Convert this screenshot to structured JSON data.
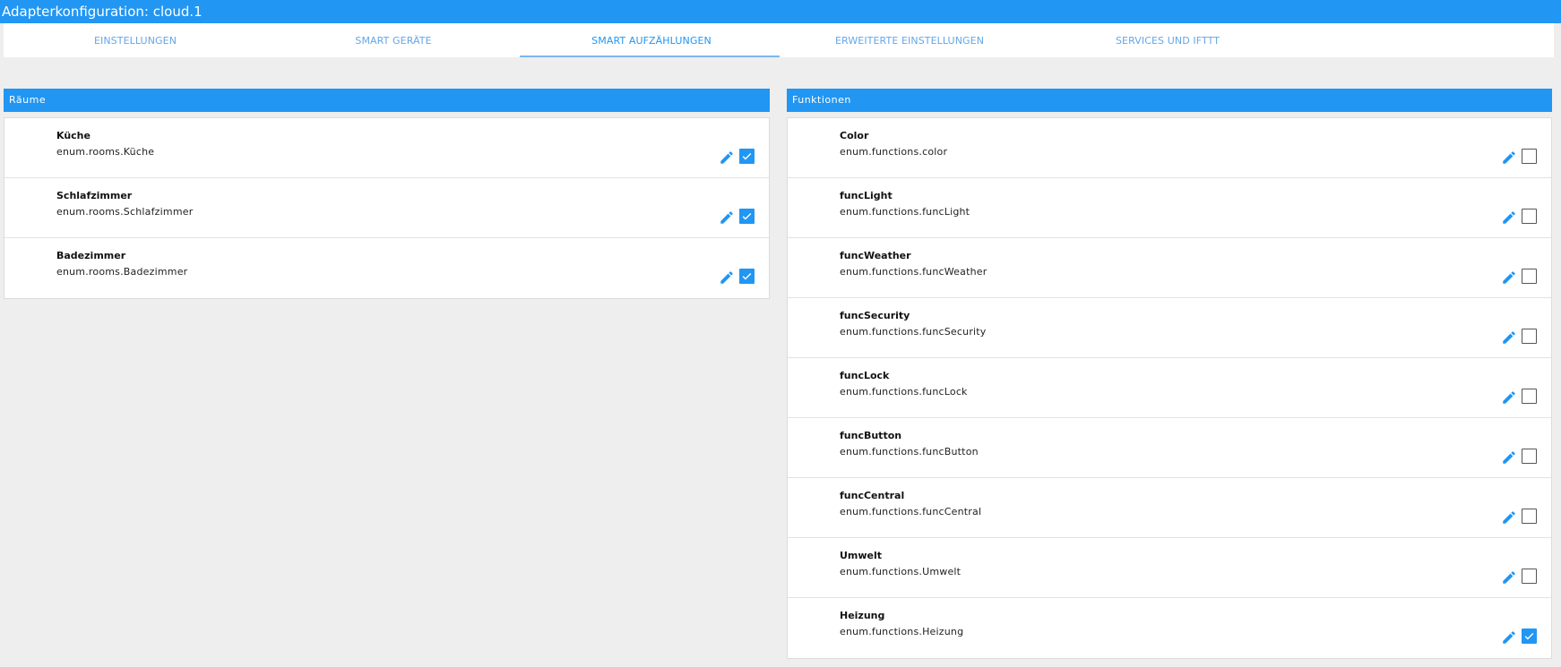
{
  "window": {
    "title": "Adapterkonfiguration: cloud.1"
  },
  "tabs": [
    {
      "label": "EINSTELLUNGEN",
      "active": false
    },
    {
      "label": "SMART GERÄTE",
      "active": false
    },
    {
      "label": "SMART AUFZÄHLUNGEN",
      "active": true
    },
    {
      "label": "ERWEITERTE EINSTELLUNGEN",
      "active": false
    },
    {
      "label": "SERVICES UND IFTTT",
      "active": false
    }
  ],
  "colors": {
    "accent": "#2196f3",
    "background": "#eeeeee"
  },
  "rooms": {
    "title": "Räume",
    "items": [
      {
        "name": "Küche",
        "id": "enum.rooms.Küche",
        "enabled": true,
        "edit_icon": "pencil-icon"
      },
      {
        "name": "Schlafzimmer",
        "id": "enum.rooms.Schlafzimmer",
        "enabled": true,
        "edit_icon": "pencil-icon"
      },
      {
        "name": "Badezimmer",
        "id": "enum.rooms.Badezimmer",
        "enabled": true,
        "edit_icon": "pencil-icon"
      }
    ]
  },
  "functions": {
    "title": "Funktionen",
    "items": [
      {
        "name": "Color",
        "id": "enum.functions.color",
        "enabled": false,
        "edit_icon": "pencil-icon"
      },
      {
        "name": "funcLight",
        "id": "enum.functions.funcLight",
        "enabled": false,
        "edit_icon": "pencil-icon"
      },
      {
        "name": "funcWeather",
        "id": "enum.functions.funcWeather",
        "enabled": false,
        "edit_icon": "pencil-icon"
      },
      {
        "name": "funcSecurity",
        "id": "enum.functions.funcSecurity",
        "enabled": false,
        "edit_icon": "pencil-icon"
      },
      {
        "name": "funcLock",
        "id": "enum.functions.funcLock",
        "enabled": false,
        "edit_icon": "pencil-icon"
      },
      {
        "name": "funcButton",
        "id": "enum.functions.funcButton",
        "enabled": false,
        "edit_icon": "pencil-icon"
      },
      {
        "name": "funcCentral",
        "id": "enum.functions.funcCentral",
        "enabled": false,
        "edit_icon": "pencil-icon"
      },
      {
        "name": "Umwelt",
        "id": "enum.functions.Umwelt",
        "enabled": false,
        "edit_icon": "pencil-icon"
      },
      {
        "name": "Heizung",
        "id": "enum.functions.Heizung",
        "enabled": true,
        "edit_icon": "pencil-icon"
      }
    ]
  }
}
